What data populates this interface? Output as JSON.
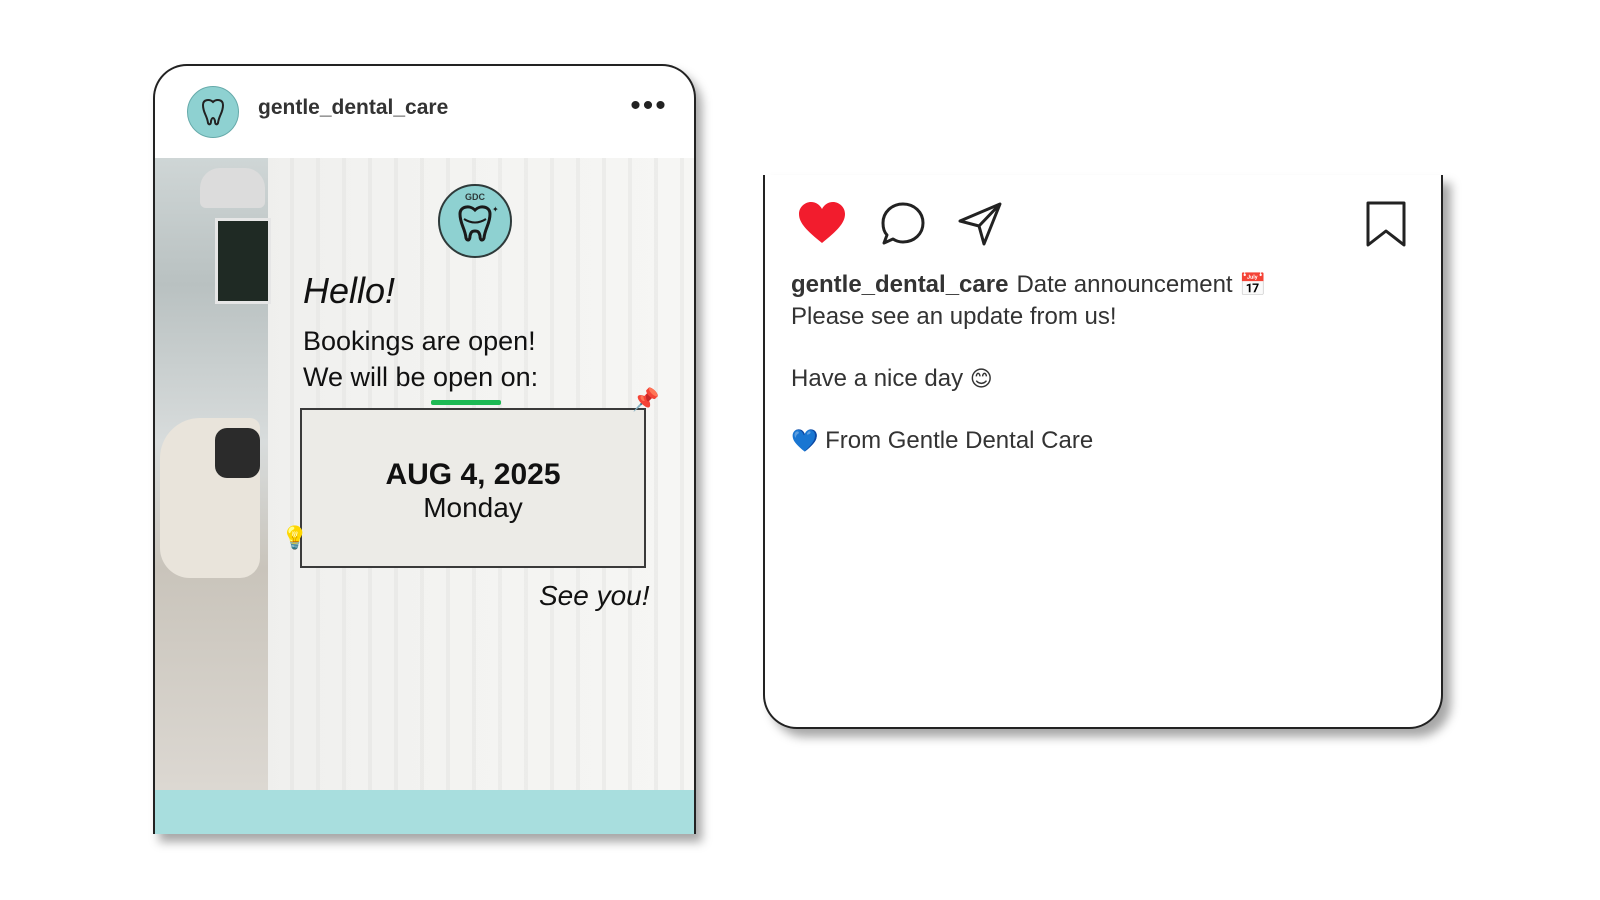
{
  "post": {
    "username": "gentle_dental_care",
    "more_label": "•••",
    "avatar_icon": "tooth-logo-icon",
    "logo_text": "GDC",
    "image": {
      "hello": "Hello!",
      "line1": "Bookings are open!",
      "line2_pre": "We will be ",
      "line2_highlight": "open",
      "line2_post": " on:",
      "date": "AUG 4, 2025",
      "day": "Monday",
      "closing": "See you!",
      "pin_icon": "📌",
      "bulb_icon": "💡"
    },
    "colors": {
      "accent_teal": "#a8dede",
      "underline_green": "#1db954"
    }
  },
  "caption_card": {
    "actions": {
      "like_icon": "heart-icon",
      "comment_icon": "comment-icon",
      "share_icon": "send-icon",
      "save_icon": "bookmark-icon",
      "like_color": "#f21c2d"
    },
    "username": "gentle_dental_care",
    "caption_line1": "Date announcement",
    "calendar_emoji": "📅",
    "caption_line2": "Please see an update from us!",
    "caption_line3": "Have a nice day",
    "smile_emoji": "😊",
    "caption_line4": "From Gentle Dental Care",
    "heart_emoji": "💙"
  }
}
